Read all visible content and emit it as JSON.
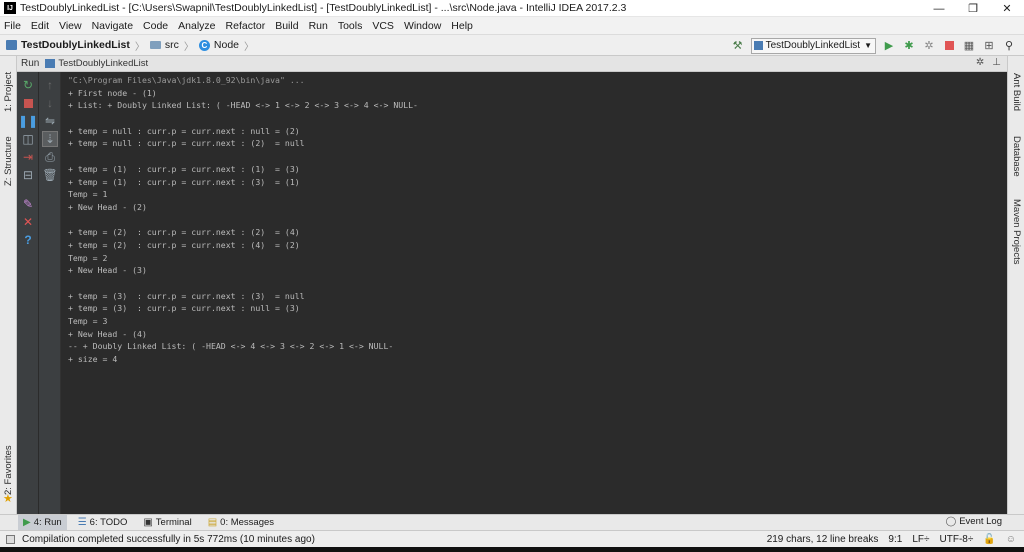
{
  "window": {
    "title": "TestDoublyLinkedList - [C:\\Users\\Swapnil\\TestDoublyLinkedList] - [TestDoublyLinkedList] - ...\\src\\Node.java - IntelliJ IDEA 2017.2.3",
    "app_icon": "IJ",
    "minimize": "—",
    "restore": "❐",
    "close": "✕"
  },
  "menu": [
    "File",
    "Edit",
    "View",
    "Navigate",
    "Code",
    "Analyze",
    "Refactor",
    "Build",
    "Run",
    "Tools",
    "VCS",
    "Window",
    "Help"
  ],
  "navbar": {
    "project": "TestDoublyLinkedList",
    "folder": "src",
    "file": "Node",
    "class_badge": "C",
    "run_config": "TestDoublyLinkedList"
  },
  "left_stripe": {
    "project_tab": "1: Project",
    "structure_tab": "Z: Structure",
    "favorites_tab": "2: Favorites"
  },
  "right_stripe": {
    "ant_tab": "Ant Build",
    "database_tab": "Database",
    "maven_tab": "Maven Projects"
  },
  "run_window": {
    "label": "Run",
    "tab": "TestDoublyLinkedList",
    "settings": "✲",
    "pin": "⊥"
  },
  "console": {
    "lines": [
      "\"C:\\Program Files\\Java\\jdk1.8.0_92\\bin\\java\" ...",
      "+ First node - (1)",
      "+ List: + Doubly Linked List: ( -HEAD <-> 1 <-> 2 <-> 3 <-> 4 <-> NULL-",
      "",
      "+ temp = null : curr.p = curr.next : null = (2)",
      "+ temp = null : curr.p = curr.next : (2)  = null",
      "",
      "+ temp = (1)  : curr.p = curr.next : (1)  = (3)",
      "+ temp = (1)  : curr.p = curr.next : (3)  = (1)",
      "Temp = 1",
      "+ New Head - (2)",
      "",
      "+ temp = (2)  : curr.p = curr.next : (2)  = (4)",
      "+ temp = (2)  : curr.p = curr.next : (4)  = (2)",
      "Temp = 2",
      "+ New Head - (3)",
      "",
      "+ temp = (3)  : curr.p = curr.next : (3)  = null",
      "+ temp = (3)  : curr.p = curr.next : null = (3)",
      "Temp = 3",
      "+ New Head - (4)",
      "-- + Doubly Linked List: ( -HEAD <-> 4 <-> 3 <-> 2 <-> 1 <-> NULL-",
      "+ size = 4"
    ]
  },
  "bottom_tabs": {
    "run": "4: Run",
    "todo": "6: TODO",
    "terminal": "Terminal",
    "messages": "0: Messages",
    "event_log": "Event Log"
  },
  "status": {
    "message": "Compilation completed successfully in 5s 772ms (10 minutes ago)",
    "chars": "219 chars, 12 line breaks",
    "position": "9:1",
    "line_sep": "LF÷",
    "encoding": "UTF-8÷"
  },
  "colors": {
    "console_bg": "#2b2b2b",
    "console_text": "#bbbbbb",
    "toolbar_bg": "#3c3f41",
    "run_green": "#59a869",
    "stop_red": "#e05555"
  }
}
